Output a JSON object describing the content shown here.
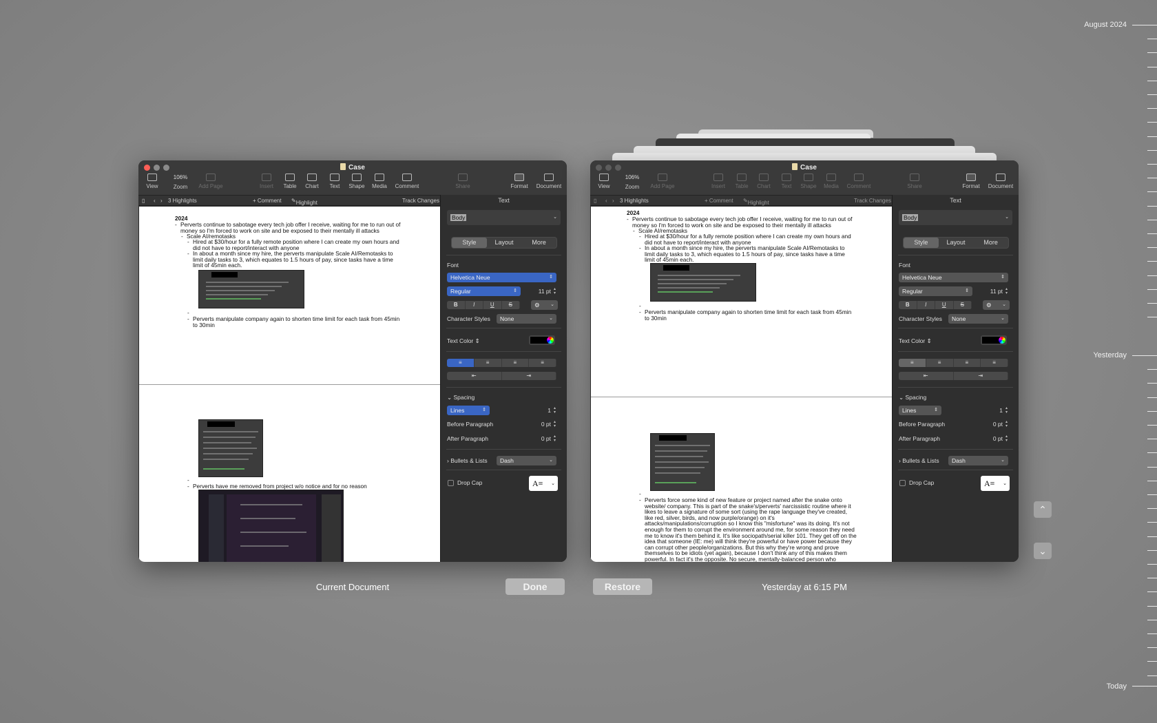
{
  "document_title": "Case",
  "toolbar": {
    "view": "View",
    "zoom_value": "106%",
    "zoom": "Zoom",
    "add_page": "Add Page",
    "insert": "Insert",
    "table": "Table",
    "chart": "Chart",
    "text": "Text",
    "shape": "Shape",
    "media": "Media",
    "comment": "Comment",
    "share": "Share",
    "format": "Format",
    "document": "Document"
  },
  "subbar": {
    "highlights": "3 Highlights",
    "comment": "+ Comment",
    "highlight": "Highlight",
    "track_changes": "Track Changes"
  },
  "inspector": {
    "header": "Text",
    "paragraph_style": "Body",
    "tabs": [
      "Style",
      "Layout",
      "More"
    ],
    "font_label": "Font",
    "font_family": "Helvetica Neue",
    "font_weight": "Regular",
    "font_size": "11 pt",
    "bold": "B",
    "italic": "I",
    "underline": "U",
    "strike": "S",
    "character_styles_label": "Character Styles",
    "character_styles_value": "None",
    "text_color_label": "Text Color",
    "spacing_label": "Spacing",
    "spacing_type": "Lines",
    "spacing_value": "1",
    "before_paragraph_label": "Before Paragraph",
    "before_paragraph_value": "0 pt",
    "after_paragraph_label": "After Paragraph",
    "after_paragraph_value": "0 pt",
    "bullets_label": "Bullets & Lists",
    "bullets_value": "Dash",
    "drop_cap_label": "Drop Cap"
  },
  "left_doc": {
    "year": "2024",
    "b1": "Perverts continue to sabotage every tech job offer I receive, waiting for me to run out of money so I'm forced to work on site and be exposed to their mentally ill attacks",
    "b2": "Scale AI/remotasks",
    "b3": "Hired at $30/hour for a fully remote position where I can create my own hours and did not have to report/interact with anyone",
    "b4": "In about a month since my hire, the perverts manipulate Scale AI/Remotasks to limit daily tasks to 3, which equates to 1.5 hours of pay, since tasks have a time limit of 45min each.",
    "b5": "Perverts manipulate company again to shorten time limit for each task from 45min to 30min",
    "b6": "Perverts have me removed from project w/o notice and for no reason"
  },
  "right_doc": {
    "b7": "Perverts force some kind of new feature or project named after the snake onto website/ company. This is part of the snake's/perverts' narcissistic routine where it likes to leave a signature of some sort (using the rape language they've created, like red, silver, birds, and now purple/orange) on it's attacks/manipulations/corruption so I know this \"misfortune\" was its doing. It's not enough for them to corrupt the environment around me, for some reason they need me to know it's them behind it. It's like sociopath/serial killer 101. They get off on the idea that someone (IE: me) will think they're powerful or have power because they can corrupt other people/organizations. But this why they're wrong and prove themselves to be idiots (yet again), because I don't think any of this makes them powerful. In fact it's the opposite. No secure, mentally-balanced person who respects others and their boundaries does these kinds of things. This is nothing more than a Napoleon complex: a small, insecure person craving power to make"
  },
  "captions": {
    "current": "Current Document",
    "done": "Done",
    "restore": "Restore",
    "version_time": "Yesterday at 6:15 PM"
  },
  "timeline": {
    "top": "August 2024",
    "middle": "Yesterday",
    "bottom": "Today"
  },
  "colors": {
    "accent": "#3a66c4",
    "close": "#ff5f57"
  }
}
